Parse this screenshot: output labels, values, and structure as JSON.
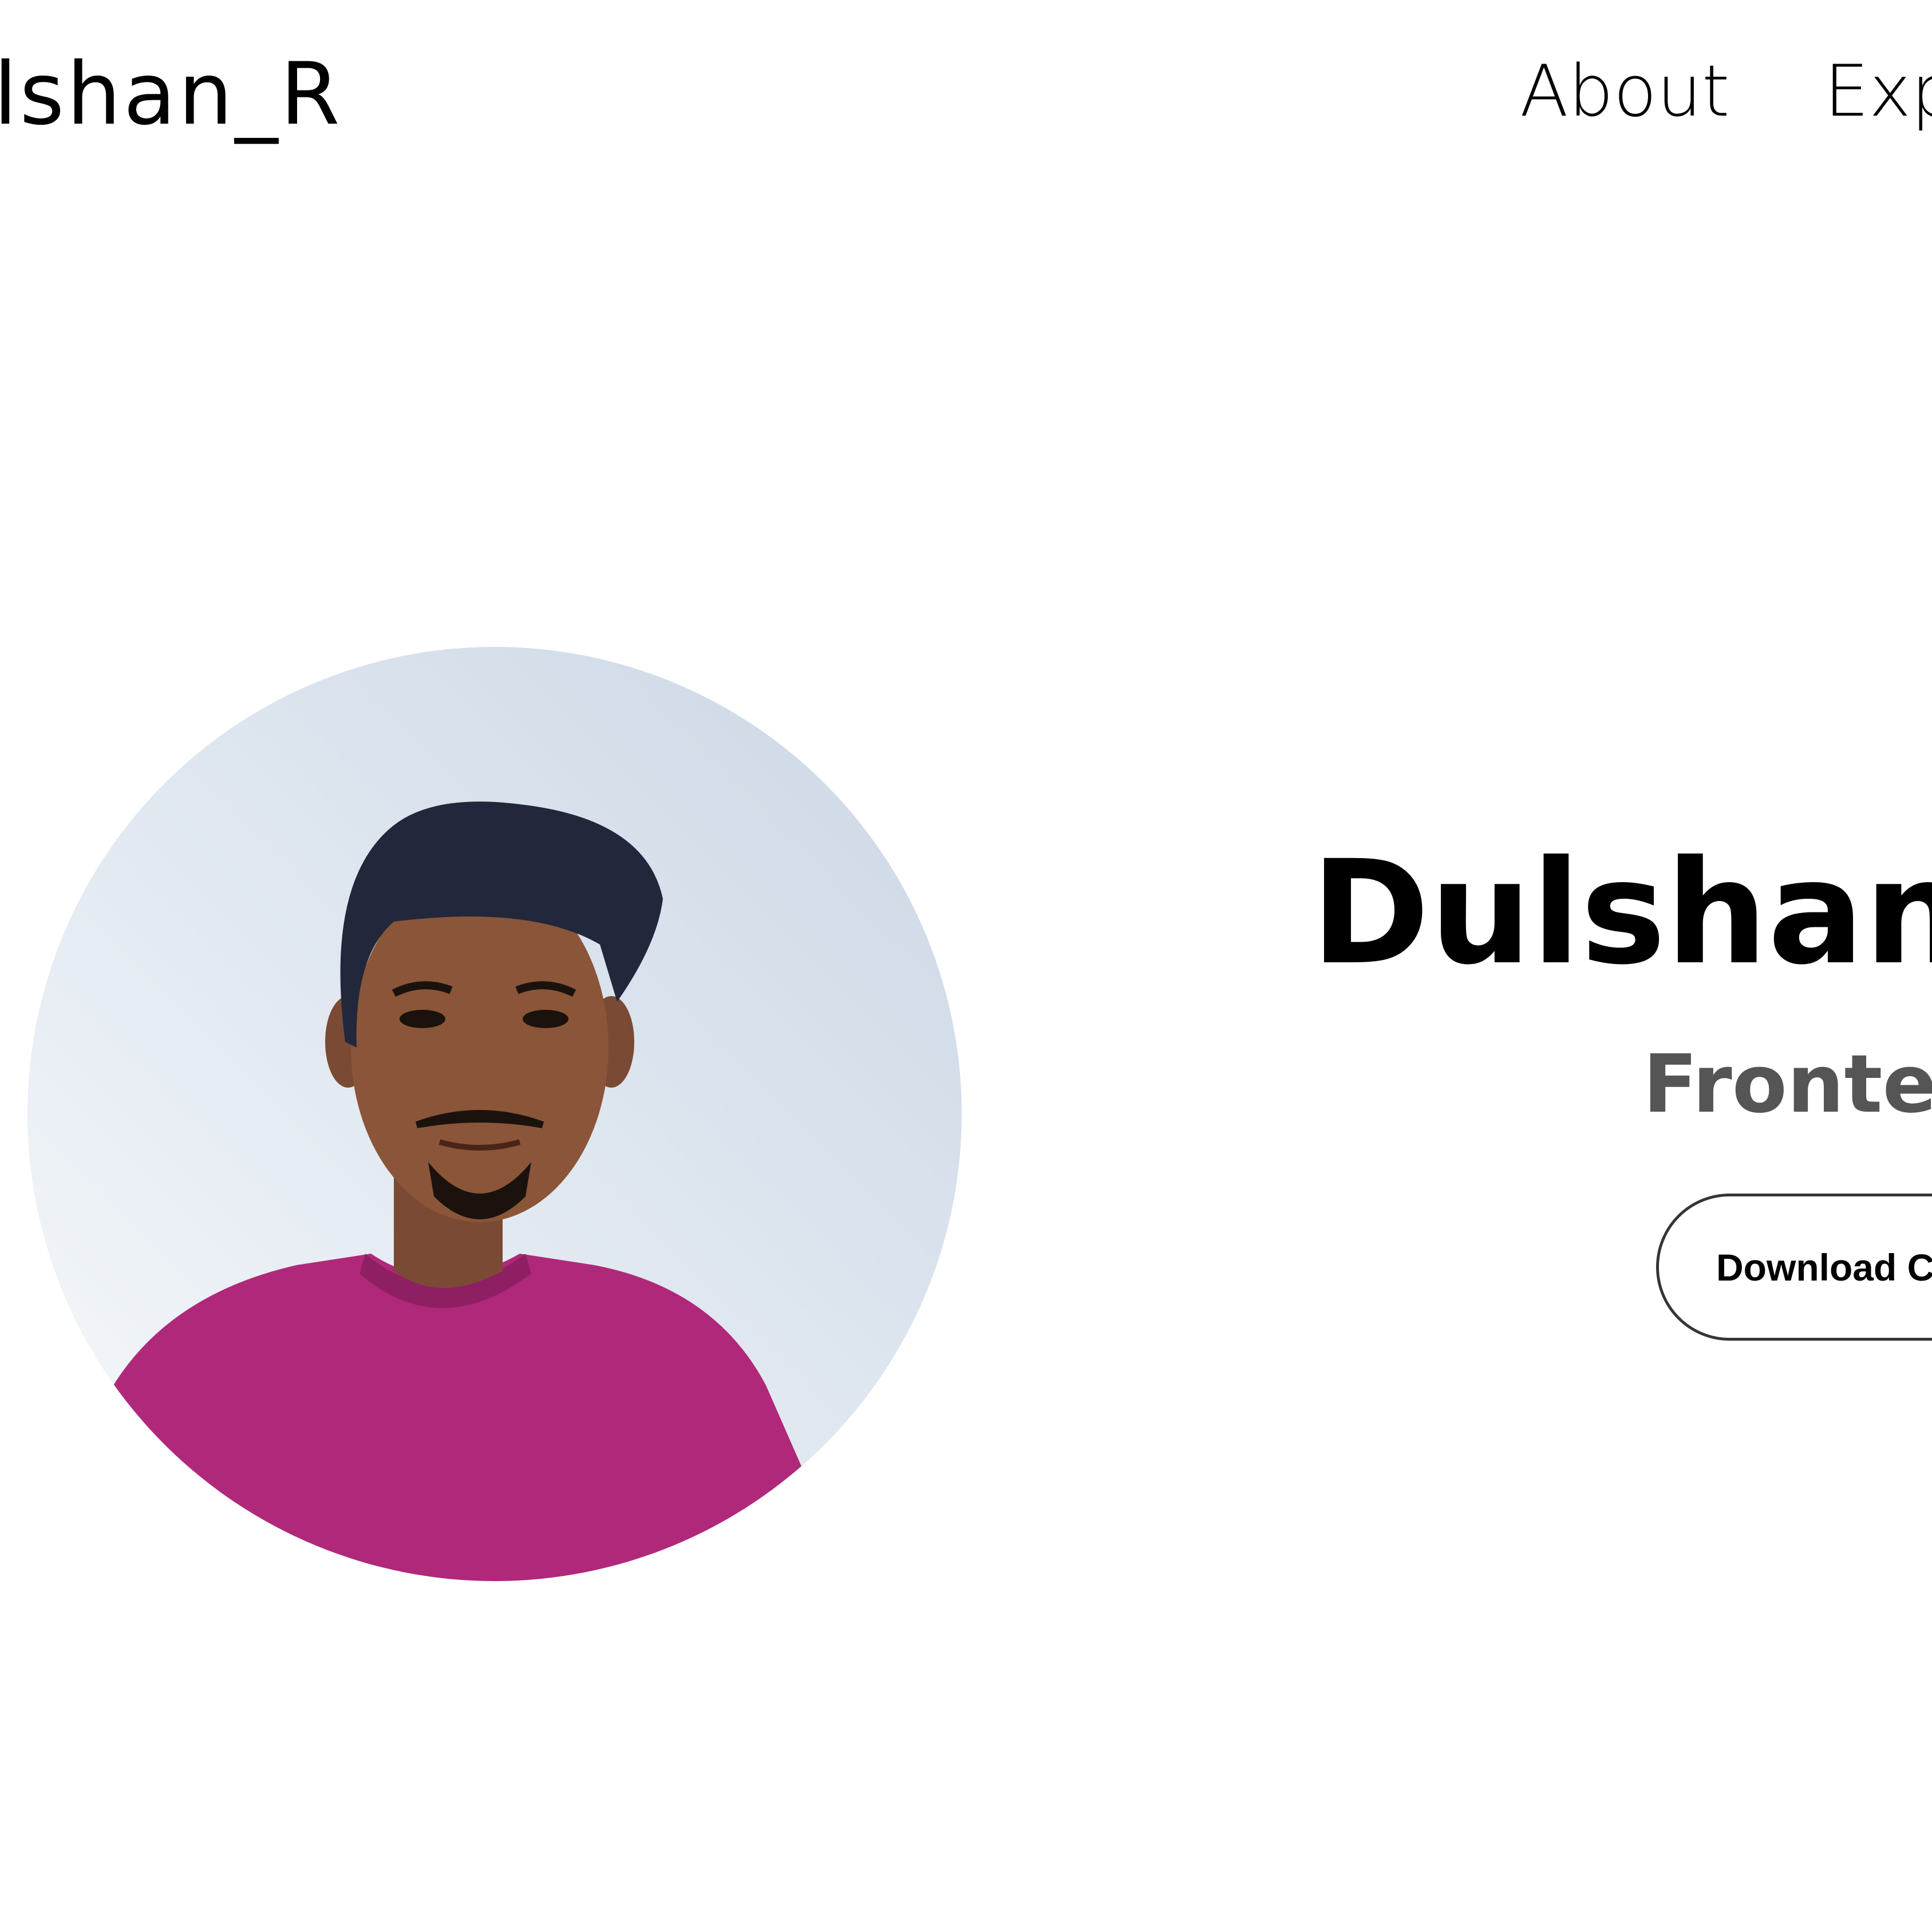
{
  "header": {
    "logo_text": "Dulshan_R",
    "nav": [
      {
        "label": "About"
      },
      {
        "label": "Experience"
      }
    ]
  },
  "hero": {
    "profile_image_alt": "Profile picture",
    "name": "Dulshan Rathnayaka",
    "title": "Frontend Developer",
    "download_cv_label": "Download CV"
  },
  "colors": {
    "background": "#ffffff",
    "text_primary": "#000000",
    "text_secondary": "#555555",
    "button_border": "#353535",
    "shirt": "#b0287a",
    "photo_bg_light": "#f8fafc",
    "photo_bg_dark": "#cbd7e5"
  }
}
